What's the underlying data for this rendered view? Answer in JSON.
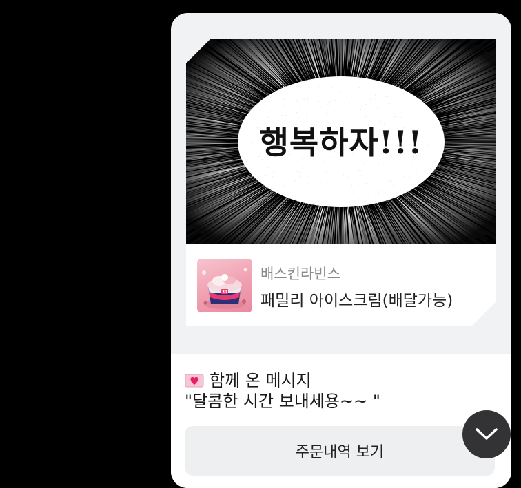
{
  "gift_card": {
    "headline": "행복하자!!!",
    "brand": "배스킨라빈스",
    "product_name": "패밀리 아이스크림(배달가능)"
  },
  "message": {
    "icon": "heart-envelope-icon",
    "title": "함께 온 메시지",
    "text": "\"달콤한 시간 보내세용~~ \""
  },
  "actions": {
    "order_history_label": "주문내역 보기",
    "scroll_down_icon": "chevron-down-icon"
  },
  "colors": {
    "background": "#000000",
    "bubble": "#f1f2f4",
    "accent_pink": "#e91e63"
  }
}
